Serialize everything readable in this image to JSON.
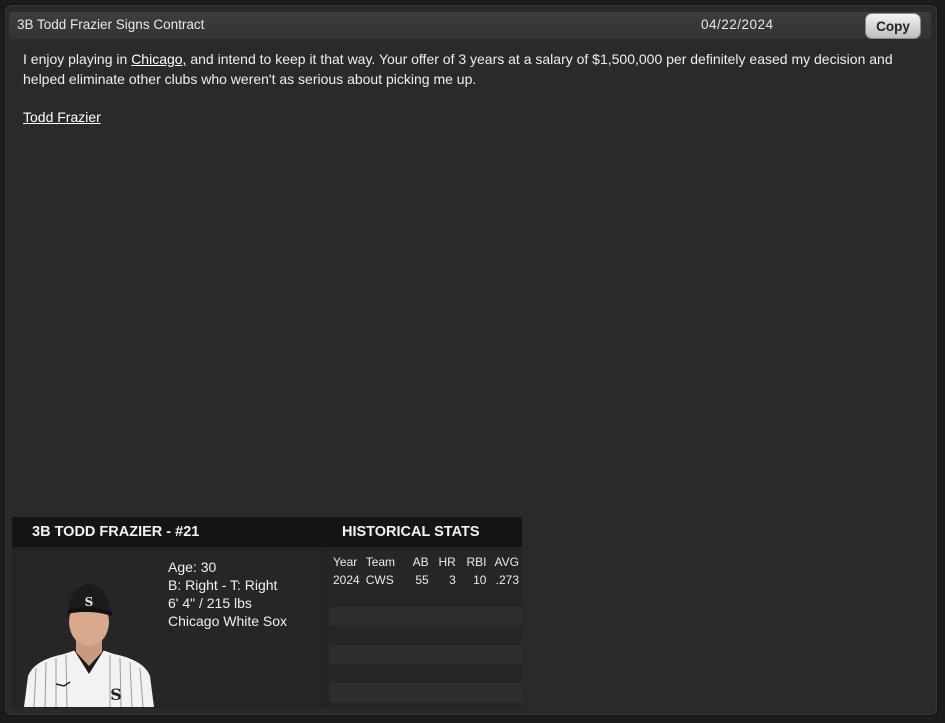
{
  "titlebar": {
    "title": "3B Todd Frazier Signs Contract",
    "date": "04/22/2024",
    "copy_label": "Copy"
  },
  "message": {
    "part1": "I enjoy playing in ",
    "city_link": "Chicago,",
    "part2": " and intend to keep it that way. Your offer of 3 years at a salary of $1,500,000 per definitely eased my decision and helped eliminate other clubs who weren't as serious about picking me up.",
    "signature": "Todd Frazier"
  },
  "player_card": {
    "name_header": "3B TODD FRAZIER - #21",
    "stats_header": "HISTORICAL STATS",
    "age": "Age: 30",
    "bats_throws": "B: Right - T: Right",
    "size": "6' 4\" / 215 lbs",
    "team": "Chicago White Sox",
    "photo_icon": "player-portrait-icon"
  },
  "stats": {
    "columns": [
      "Year",
      "Team",
      "AB",
      "HR",
      "RBI",
      "AVG"
    ],
    "rows": [
      [
        "2024",
        "CWS",
        "55",
        "3",
        "10",
        ".273"
      ]
    ]
  },
  "colors": {
    "background": "#1c1c1c",
    "panel": "#2a2a2a",
    "header_bar": "#151515",
    "button": "#d9d9d9"
  }
}
